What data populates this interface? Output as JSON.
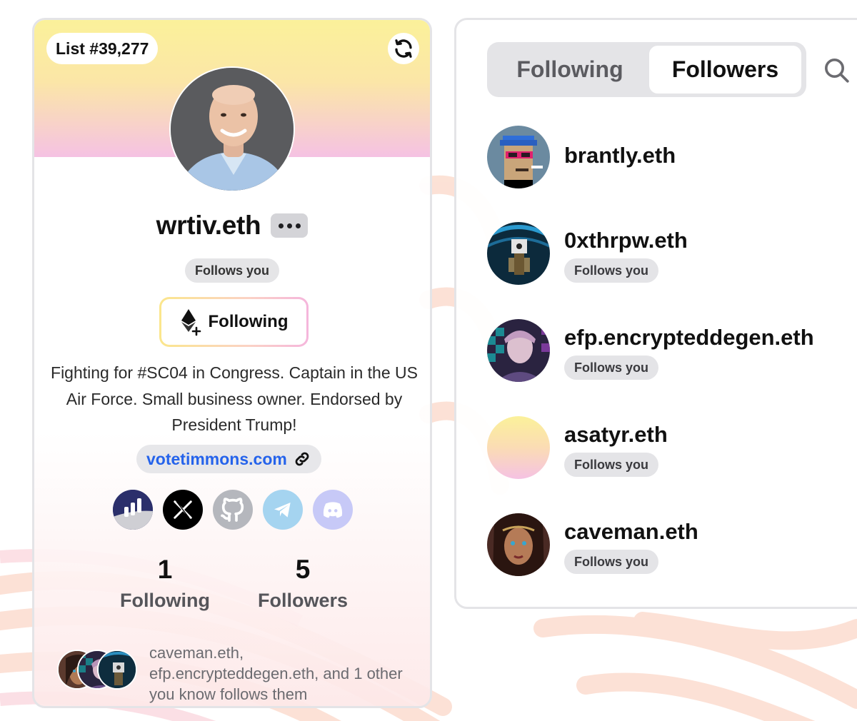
{
  "profile": {
    "list_badge": "List #39,277",
    "name": "wrtiv.eth",
    "follows_you": "Follows you",
    "follow_button": "Following",
    "bio": "Fighting for #SC04 in Congress. Captain in the US Air Force. Small business owner. Endorsed by President Trump!",
    "website": "votetimmons.com",
    "socials": [
      {
        "icon": "dune-icon",
        "color": "#2b2f6b"
      },
      {
        "icon": "x-icon",
        "color": "#000000"
      },
      {
        "icon": "github-icon",
        "color": "#9ca3af"
      },
      {
        "icon": "telegram-icon",
        "color": "#a5d4f0"
      },
      {
        "icon": "discord-icon",
        "color": "#c7c9f7"
      }
    ],
    "stats": {
      "following_count": "1",
      "following_label": "Following",
      "followers_count": "5",
      "followers_label": "Followers"
    },
    "mutuals_text": "caveman.eth, efp.encrypteddegen.eth, and 1 other you know follows them"
  },
  "panel": {
    "tabs": [
      {
        "label": "Following",
        "active": false
      },
      {
        "label": "Followers",
        "active": true
      }
    ],
    "search_icon": "search-icon",
    "followers": [
      {
        "name": "brantly.eth",
        "follows_you": ""
      },
      {
        "name": "0xthrpw.eth",
        "follows_you": "Follows you"
      },
      {
        "name": "efp.encrypteddegen.eth",
        "follows_you": "Follows you"
      },
      {
        "name": "asatyr.eth",
        "follows_you": "Follows you"
      },
      {
        "name": "caveman.eth",
        "follows_you": "Follows you"
      }
    ]
  },
  "colors": {
    "accent_link": "#2563eb",
    "banner_top": "#fbf19a",
    "banner_bottom": "#f5c2e3",
    "pill_bg": "#e4e4e7"
  }
}
